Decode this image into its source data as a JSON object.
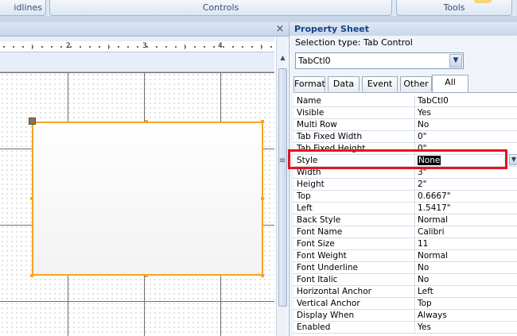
{
  "ribbon": {
    "groups": [
      {
        "label": "idlines"
      },
      {
        "label": "Controls"
      },
      {
        "label": "Tools"
      }
    ]
  },
  "design": {
    "close_glyph": "×",
    "ruler": [
      "2",
      "3",
      "4"
    ]
  },
  "property_sheet": {
    "title": "Property Sheet",
    "selection_type": "Selection type:  Tab Control",
    "object": "TabCtl0",
    "tabs": [
      "Format",
      "Data",
      "Event",
      "Other",
      "All"
    ],
    "active_tab": "All",
    "rows": [
      {
        "name": "Name",
        "value": "TabCtl0"
      },
      {
        "name": "Visible",
        "value": "Yes"
      },
      {
        "name": "Multi Row",
        "value": "No"
      },
      {
        "name": "Tab Fixed Width",
        "value": "0\""
      },
      {
        "name": "Tab Fixed Height",
        "value": "0\""
      },
      {
        "name": "Style",
        "value": "None"
      },
      {
        "name": "Width",
        "value": "3\""
      },
      {
        "name": "Height",
        "value": "2\""
      },
      {
        "name": "Top",
        "value": "0.6667\""
      },
      {
        "name": "Left",
        "value": "1.5417\""
      },
      {
        "name": "Back Style",
        "value": "Normal"
      },
      {
        "name": "Font Name",
        "value": "Calibri"
      },
      {
        "name": "Font Size",
        "value": "11"
      },
      {
        "name": "Font Weight",
        "value": "Normal"
      },
      {
        "name": "Font Underline",
        "value": "No"
      },
      {
        "name": "Font Italic",
        "value": "No"
      },
      {
        "name": "Horizontal Anchor",
        "value": "Left"
      },
      {
        "name": "Vertical Anchor",
        "value": "Top"
      },
      {
        "name": "Display When",
        "value": "Always"
      },
      {
        "name": "Enabled",
        "value": "Yes"
      }
    ],
    "selected_row": "Style"
  },
  "colors": {
    "highlight": "#e8121c",
    "selection_border": "#f5a623"
  }
}
